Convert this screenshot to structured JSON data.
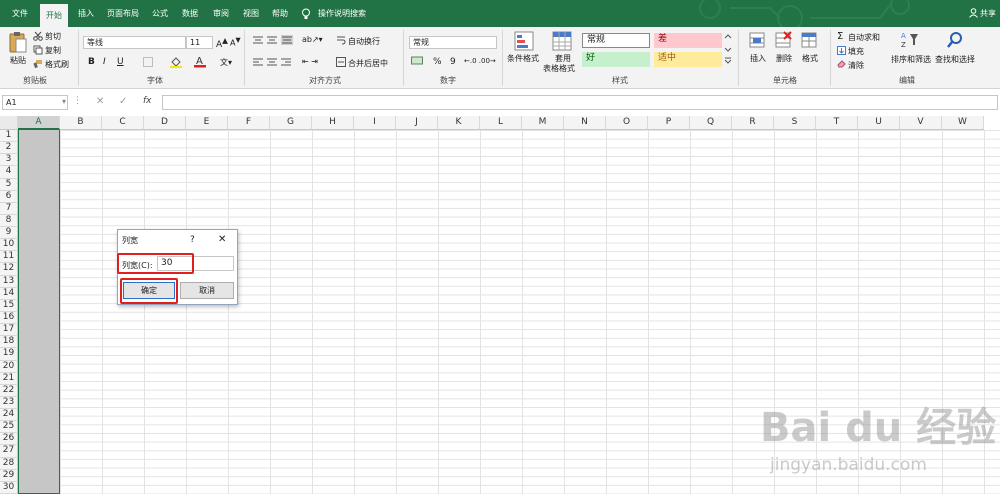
{
  "menu": {
    "tabs": [
      "文件",
      "开始",
      "插入",
      "页面布局",
      "公式",
      "数据",
      "审阅",
      "视图",
      "帮助"
    ],
    "search_label": "操作说明搜索",
    "share_label": "共享"
  },
  "ribbon": {
    "clipboard": {
      "paste": "粘贴",
      "cut": "剪切",
      "copy": "复制",
      "format_painter": "格式刷",
      "label": "剪贴板"
    },
    "font": {
      "name": "等线",
      "size": "11",
      "bold": "B",
      "italic": "I",
      "underline": "U",
      "label": "字体"
    },
    "alignment": {
      "wrap": "自动换行",
      "merge": "合并后居中",
      "label": "对齐方式"
    },
    "number": {
      "format": "常规",
      "percent": "%",
      "comma": "9",
      "label": "数字"
    },
    "styles": {
      "conditional": "条件格式",
      "table_fmt_1": "套用",
      "table_fmt_2": "表格格式",
      "normal": "常规",
      "bad": "差",
      "good": "好",
      "neutral": "适中",
      "label": "样式"
    },
    "cells": {
      "insert": "插入",
      "delete": "删除",
      "format": "格式",
      "label": "单元格"
    },
    "editing": {
      "autosum": "自动求和",
      "fill": "填充",
      "clear": "清除",
      "sort": "排序和筛选",
      "find": "查找和选择",
      "label": "编辑"
    }
  },
  "formula_bar": {
    "name_box": "A1",
    "fx": "fx",
    "value": ""
  },
  "sheet": {
    "columns": [
      "A",
      "B",
      "C",
      "D",
      "E",
      "F",
      "G",
      "H",
      "I",
      "J",
      "K",
      "L",
      "M",
      "N",
      "O",
      "P",
      "Q",
      "R",
      "S",
      "T",
      "U",
      "V",
      "W"
    ],
    "rows": [
      "1",
      "2",
      "3",
      "4",
      "5",
      "6",
      "7",
      "8",
      "9",
      "10",
      "11",
      "12",
      "13",
      "14",
      "15",
      "16",
      "17",
      "18",
      "19",
      "20",
      "21",
      "22",
      "23",
      "24",
      "25",
      "26",
      "27",
      "28",
      "29",
      "30"
    ]
  },
  "dialog": {
    "title": "列宽",
    "help": "?",
    "close": "✕",
    "field_label": "列宽(C):",
    "field_value": "30",
    "ok": "确定",
    "cancel": "取消"
  },
  "watermark": {
    "logo": "Bai du 经验",
    "url": "jingyan.baidu.com"
  },
  "colors": {
    "excel_green": "#217346",
    "highlight_red": "#e02020",
    "selected_col": "#c6c6c6"
  }
}
